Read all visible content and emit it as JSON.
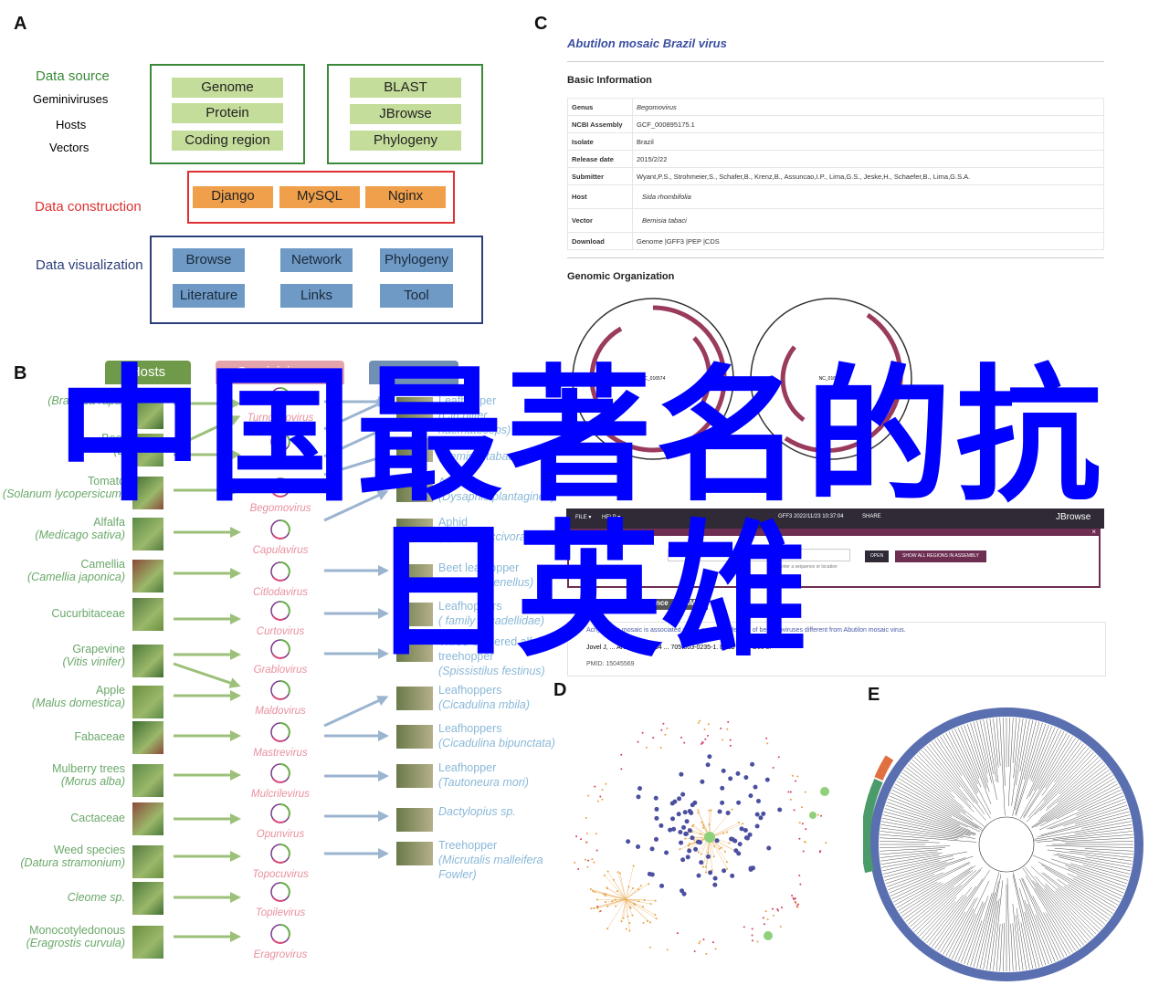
{
  "panels": {
    "a": "A",
    "b": "B",
    "c": "C",
    "d": "D",
    "e": "E"
  },
  "panel_a": {
    "data_source": {
      "title": "Data source",
      "items": [
        "Geminiviruses",
        "Hosts",
        "Vectors"
      ],
      "buttons_left": [
        "Genome",
        "Protein",
        "Coding region"
      ],
      "buttons_right": [
        "BLAST",
        "JBrowse",
        "Phylogeny"
      ]
    },
    "data_construction": {
      "title": "Data construction",
      "buttons": [
        "Django",
        "MySQL",
        "Nginx"
      ]
    },
    "data_visualization": {
      "title": "Data visualization",
      "buttons": [
        "Browse",
        "Network",
        "Phylogeny",
        "Literature",
        "Links",
        "Tool"
      ]
    },
    "colors": {
      "green": "#3a8a3a",
      "red": "#e03030",
      "navy": "#2c3e7a"
    }
  },
  "panel_b": {
    "headers": {
      "hosts": "Hosts",
      "viruses": "Geminiviruses",
      "insects": "Insects"
    },
    "hosts": [
      {
        "name": "",
        "latin": "(Brassica rapa)"
      },
      {
        "name": "Beet",
        "latin": "(B"
      },
      {
        "name": "Tomato",
        "latin": "(Solanum lycopersicum)"
      },
      {
        "name": "Alfalfa",
        "latin": "(Medicago sativa)"
      },
      {
        "name": "Camellia",
        "latin": "(Camellia japonica)"
      },
      {
        "name": "Cucurbitaceae",
        "latin": ""
      },
      {
        "name": "Grapevine",
        "latin": "(Vitis vinifer)"
      },
      {
        "name": "Apple",
        "latin": "(Malus domestica)"
      },
      {
        "name": "Fabaceae",
        "latin": ""
      },
      {
        "name": "Mulberry trees",
        "latin": "(Morus alba)"
      },
      {
        "name": "Cactaceae",
        "latin": ""
      },
      {
        "name": "Weed species",
        "latin": "(Datura stramonium)"
      },
      {
        "name": "",
        "latin": "Cleome sp."
      },
      {
        "name": "Monocotyledonous",
        "latin": "(Eragrostis curvula)"
      }
    ],
    "viruses": [
      "Turncurtovirus",
      "Becurtovirus",
      "Begomovirus",
      "Capulavirus",
      "Citlodavirus",
      "Curtovirus",
      "Grablovirus",
      "Maldovirus",
      "Mastrevirus",
      "Mulcrilevirus",
      "Opunvirus",
      "Topocuvirus",
      "Topilevirus",
      "Eragrovirus"
    ],
    "insects": [
      {
        "name": "Leafhopper",
        "latin": "(Circulifer haematoceps)"
      },
      {
        "name": "Whitefly",
        "latin": "(Bemisia tabaci)"
      },
      {
        "name": "Aphid",
        "latin": "(Dysaphis plantaginea)"
      },
      {
        "name": "Aphid",
        "latin": "(Aphis craccivora)"
      },
      {
        "name": "Beet leafhopper",
        "latin": "(Circulifer tenellus)"
      },
      {
        "name": "Leafhoppers",
        "latin": "( family Cicadellidae)"
      },
      {
        "name": "Three-cornered alfalfa treehopper",
        "latin": "(Spissistilus festinus)"
      },
      {
        "name": "Leafhoppers",
        "latin": "(Cicadulina mbila)"
      },
      {
        "name": "Leafhoppers",
        "latin": "(Cicadulina bipunctata)"
      },
      {
        "name": "Leafhopper",
        "latin": "(Tautoneura mori)"
      },
      {
        "name": "",
        "latin": "Dactylopius sp."
      },
      {
        "name": "Treehopper",
        "latin": "(Micrutalis  malleifera Fowler)"
      }
    ],
    "colors": {
      "hosts": "#6e9a4a",
      "viruses": "#e4a4ac",
      "insects": "#6f8fb5"
    }
  },
  "panel_c": {
    "title": "Abutilon mosaic Brazil virus",
    "basic_info_title": "Basic Information",
    "rows": [
      {
        "key": "Genus",
        "value": "Begomovirus"
      },
      {
        "key": "NCBI Assembly",
        "value": "GCF_000895175.1"
      },
      {
        "key": "Isolate",
        "value": "Brazil"
      },
      {
        "key": "Release date",
        "value": "2015/2/22"
      },
      {
        "key": "Submitter",
        "value": "Wyant,P.S., Strohmeier,S., Schafer,B., Krenz,B., Assuncao,I.P., Lima,G.S., Jeske,H., Schaefer,B., Lima,G.S.A."
      },
      {
        "key": "Host",
        "value": "Sida rhombifolia"
      },
      {
        "key": "Vector",
        "value": "Bemisia tabaci"
      },
      {
        "key": "Download",
        "value": "Genome |GFF3 |PEP |CDS"
      }
    ],
    "genomic_title": "Genomic Organization",
    "genome_labels": [
      "NC_016574",
      "NC_016575"
    ],
    "jbrowse": {
      "title": "JBrowse",
      "menu": [
        "FILE ▾",
        "HELP ▾"
      ],
      "session": "GFF3 2022/11/23 10:37:04",
      "share": "SHARE",
      "logo": "JBrowse",
      "search_value": "574.1",
      "hint": "Enter a sequence or location",
      "open": "OPEN",
      "show_all": "SHOW ALL REGIONS IN ASSEMBLY",
      "close": "×"
    },
    "reference": {
      "tabs": [
        "Reference",
        "More Reference",
        "PubMed"
      ],
      "text": "Achyranthia mosaic is associated with a complex infection of begomoviruses different from Abutilon mosaic virus.",
      "citation": "Jovel J, ... Arch Virol. 2004 ... 705-003-0235-1. Epub 2003 Dec 8.",
      "pmid": "PMID: 15045569"
    }
  },
  "overlay": {
    "line1": "中国最著名的抗",
    "line2": "日英雄",
    "color": "#0000ff"
  }
}
